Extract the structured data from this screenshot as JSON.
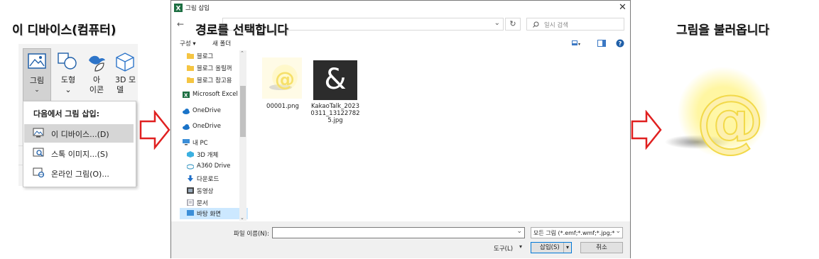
{
  "captions": {
    "left": "이 디바이스(컴퓨터)",
    "middle": "경로를 선택합니다",
    "right": "그림을 불러옵니다"
  },
  "ribbon": {
    "picture_label": "그림",
    "shape_label": "도형",
    "icon_label_1": "아",
    "icon_label_2": "이콘",
    "model3d_label_1": "3D 모",
    "model3d_label_2": "델"
  },
  "insert_menu": {
    "header": "다음에서 그림 삽입:",
    "items": [
      {
        "label": "이 디바이스...(D)",
        "icon": "device-picture-icon"
      },
      {
        "label": "스톡 이미지...(S)",
        "icon": "stock-image-icon"
      },
      {
        "label": "온라인 그림(O)...",
        "icon": "online-picture-icon"
      }
    ]
  },
  "dialog": {
    "title": "그림 삽입",
    "search_placeholder": "일시 검색",
    "organize_label": "구성 ▾",
    "new_folder_label": "새 폴더",
    "tree": [
      {
        "label": "블로그",
        "icon": "folder-icon"
      },
      {
        "label": "블로그 올릴꺼",
        "icon": "folder-icon"
      },
      {
        "label": "블로그 참고용",
        "icon": "folder-icon"
      },
      {
        "label": "Microsoft Excel",
        "icon": "excel-icon"
      },
      {
        "label": "OneDrive",
        "icon": "onedrive-icon"
      },
      {
        "label": "OneDrive",
        "icon": "onedrive-icon"
      },
      {
        "label": "내 PC",
        "icon": "pc-icon"
      },
      {
        "label": "3D 개체",
        "icon": "3d-objects-icon"
      },
      {
        "label": "A360 Drive",
        "icon": "a360-drive-icon"
      },
      {
        "label": "다운로드",
        "icon": "download-icon"
      },
      {
        "label": "동영상",
        "icon": "video-icon"
      },
      {
        "label": "문서",
        "icon": "document-icon"
      },
      {
        "label": "바탕 화면",
        "icon": "desktop-icon"
      }
    ],
    "files": [
      {
        "name": "00001.png"
      },
      {
        "name_lines": [
          "KakaoTalk_2023",
          "0311_13122782",
          "5.jpg"
        ]
      }
    ],
    "filename_label": "파일 이름(N):",
    "filename_value": "",
    "filetype_value": "모든 그림 (*.emf;*.wmf;*.jpg;*.",
    "tools_label": "도구(L)",
    "insert_label": "삽입(S)",
    "cancel_label": "취소"
  },
  "colors": {
    "arrow_red": "#e02020",
    "selection": "#cce8ff",
    "menu_selection": "#d6d6d6",
    "folder": "#f5c542",
    "onedrive": "#1a73c8",
    "glow_yellow": "#fff27a"
  }
}
